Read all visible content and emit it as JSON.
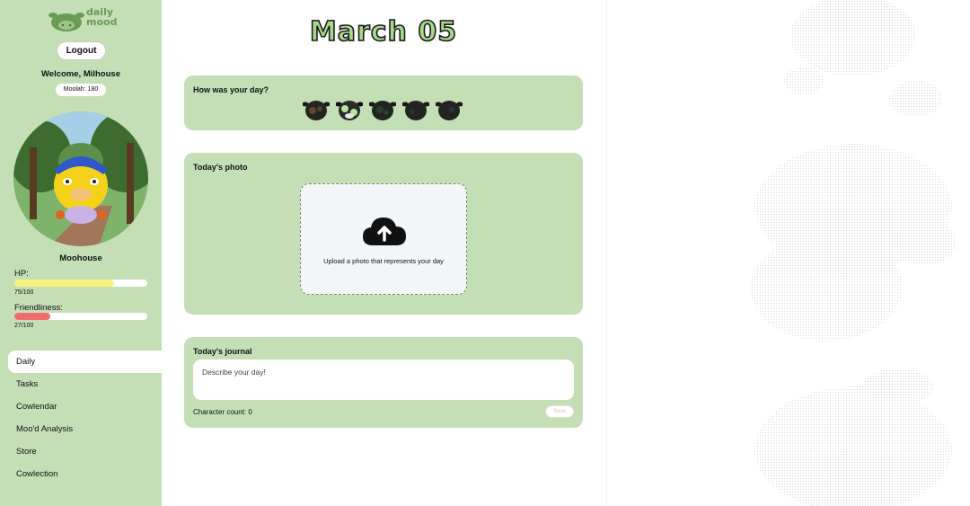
{
  "brand": {
    "logo_text_line1": "daily",
    "logo_text_line2": "mood"
  },
  "sidebar": {
    "logout_label": "Logout",
    "welcome_text": "Welcome, Milhouse",
    "moolah_label": "Moolah: 180",
    "pet_name": "Moohouse",
    "hp": {
      "label": "HP:",
      "value_text": "75/100",
      "fraction": 0.75,
      "color": "#f7f27d"
    },
    "friendliness": {
      "label": "Friendliness:",
      "value_text": "27/100",
      "fraction": 0.27,
      "color": "#f26b6b"
    },
    "nav": [
      {
        "label": "Daily",
        "active": true
      },
      {
        "label": "Tasks",
        "active": false
      },
      {
        "label": "Cowlendar",
        "active": false
      },
      {
        "label": "Moo'd Analysis",
        "active": false
      },
      {
        "label": "Store",
        "active": false
      },
      {
        "label": "Cowlection",
        "active": false
      }
    ]
  },
  "main": {
    "date_title": "March 05",
    "mood_card": {
      "title": "How was your day?",
      "selected_index": 1,
      "options": [
        "mood-1-icon",
        "mood-2-icon",
        "mood-3-icon",
        "mood-4-icon",
        "mood-5-icon"
      ]
    },
    "photo_card": {
      "title": "Today's photo",
      "upload_text": "Upload a photo that represents your day",
      "icon": "cloud-upload-icon"
    },
    "journal_card": {
      "title": "Today's journal",
      "placeholder": "Describe your day!",
      "char_count_label": "Character count: 0",
      "save_label": "Save"
    }
  },
  "colors": {
    "sidebar_bg": "#c4dfb6",
    "card_bg": "#c4dfb6",
    "accent_text": "#a7d98c"
  }
}
